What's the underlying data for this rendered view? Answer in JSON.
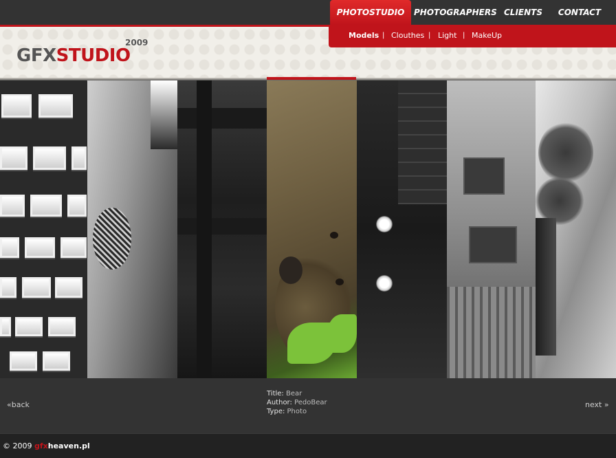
{
  "logo": {
    "gfx": "GFX",
    "studio": "STUDIO",
    "year": "2009"
  },
  "nav": {
    "items": [
      {
        "label": "PHOTOSTUDIO",
        "active": true
      },
      {
        "label": "PHOTOGRAPHERS",
        "active": false
      },
      {
        "label": "CLIENTS",
        "active": false
      },
      {
        "label": "CONTACT",
        "active": false
      }
    ]
  },
  "subnav": {
    "items": [
      {
        "label": "Models",
        "current": true
      },
      {
        "label": "Clouthes",
        "current": false
      },
      {
        "label": "Light",
        "current": false
      },
      {
        "label": "MakeUp",
        "current": false
      }
    ],
    "separator": "|"
  },
  "photo_info": {
    "title_label": "Title:",
    "title_value": "Bear",
    "author_label": "Author:",
    "author_value": "PedoBear",
    "type_label": "Type:",
    "type_value": "Photo"
  },
  "pager": {
    "back": "«back",
    "next": "next »"
  },
  "footer": {
    "prefix": "© 2009 ",
    "brand_gfx": "gfx",
    "brand_heaven": "heaven.pl"
  },
  "colors": {
    "accent": "#c0141b",
    "header_bg": "#f1efe9",
    "dark": "#333333"
  }
}
